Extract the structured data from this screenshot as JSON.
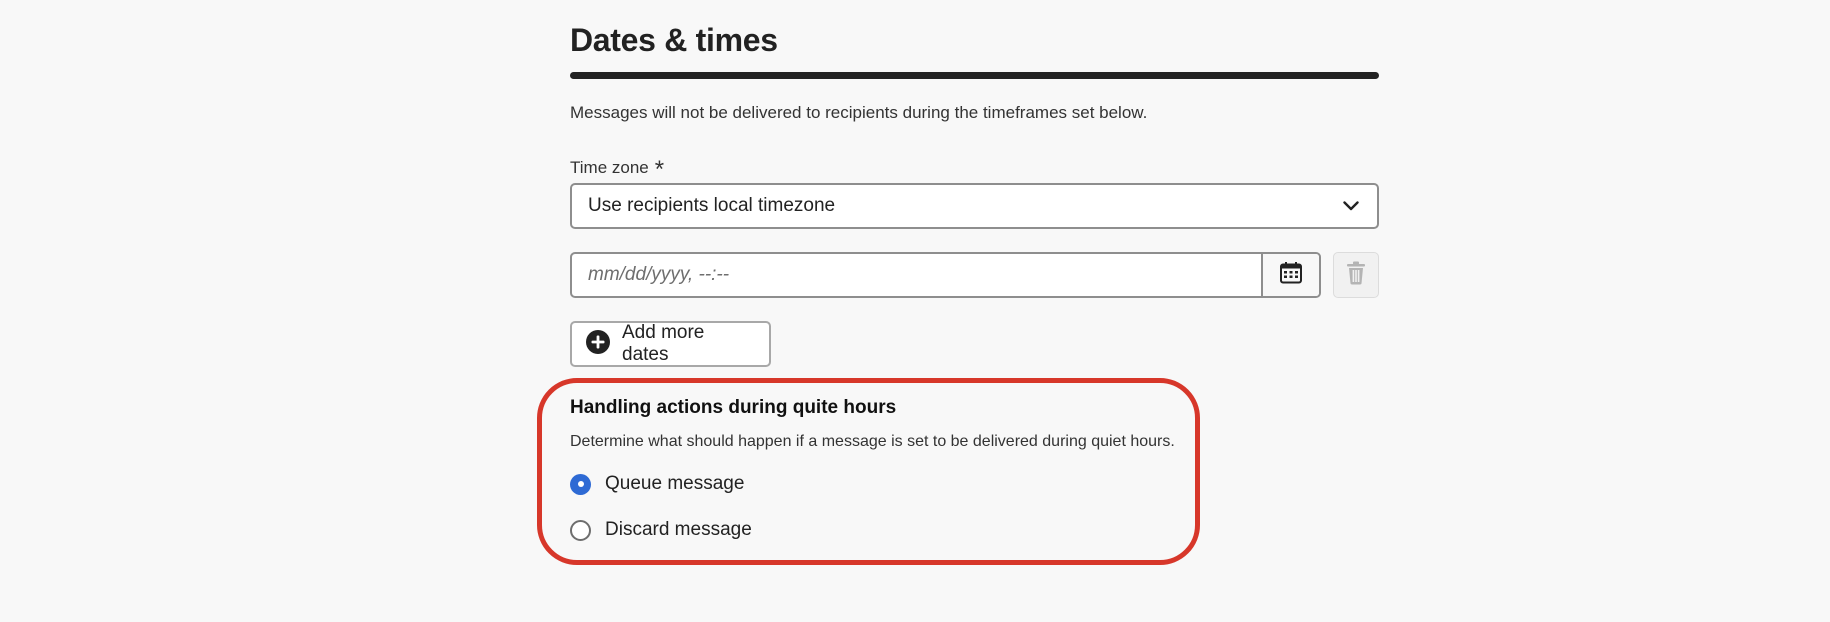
{
  "section": {
    "title": "Dates & times",
    "description": "Messages will not be delivered to recipients during the timeframes set below."
  },
  "timezone": {
    "label": "Time zone",
    "required_mark": "*",
    "selected_value": "Use recipients local timezone"
  },
  "date_field": {
    "placeholder": "mm/dd/yyyy, --:--",
    "calendar_icon": "calendar-icon",
    "delete_icon": "trash-icon",
    "delete_disabled": true
  },
  "add_dates": {
    "label": "Add more dates",
    "icon": "add-circle-icon"
  },
  "quiet_hours": {
    "title": "Handling actions during quite hours",
    "description": "Determine what should happen if a message is set to be delivered during quiet hours.",
    "options": [
      {
        "label": "Queue message",
        "selected": true
      },
      {
        "label": "Discard message",
        "selected": false
      }
    ]
  },
  "colors": {
    "accent": "#2e6ad4",
    "highlight": "#d7372a",
    "text": "#222222",
    "background": "#f8f8f8"
  }
}
